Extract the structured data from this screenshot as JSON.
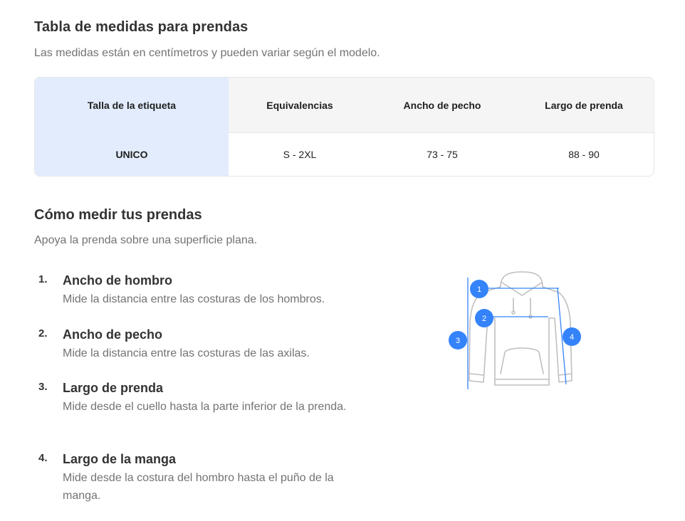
{
  "header": {
    "title": "Tabla de medidas para prendas",
    "subtitle": "Las medidas están en centímetros y pueden variar según el modelo."
  },
  "table": {
    "headers": [
      "Talla de la etiqueta",
      "Equivalencias",
      "Ancho de pecho",
      "Largo de prenda"
    ],
    "rows": [
      [
        "UNICO",
        "S - 2XL",
        "73 - 75",
        "88 - 90"
      ]
    ]
  },
  "how_to": {
    "title": "Cómo medir tus prendas",
    "subtitle": "Apoya la prenda sobre una superficie plana.",
    "steps": [
      {
        "num": "1.",
        "title": "Ancho de hombro",
        "desc": "Mide la distancia entre las costuras de los hombros."
      },
      {
        "num": "2.",
        "title": "Ancho de pecho",
        "desc": "Mide la distancia entre las costuras de las axilas."
      },
      {
        "num": "3.",
        "title": "Largo de prenda",
        "desc": "Mide desde el cuello hasta la parte inferior de la prenda."
      },
      {
        "num": "4.",
        "title": "Largo de la manga",
        "desc": "Mide desde la costura del hombro hasta el puño de la manga."
      }
    ]
  },
  "diagram": {
    "markers": [
      "1",
      "2",
      "3",
      "4"
    ],
    "accent": "#3483fa",
    "outline": "#bfbfbf"
  }
}
